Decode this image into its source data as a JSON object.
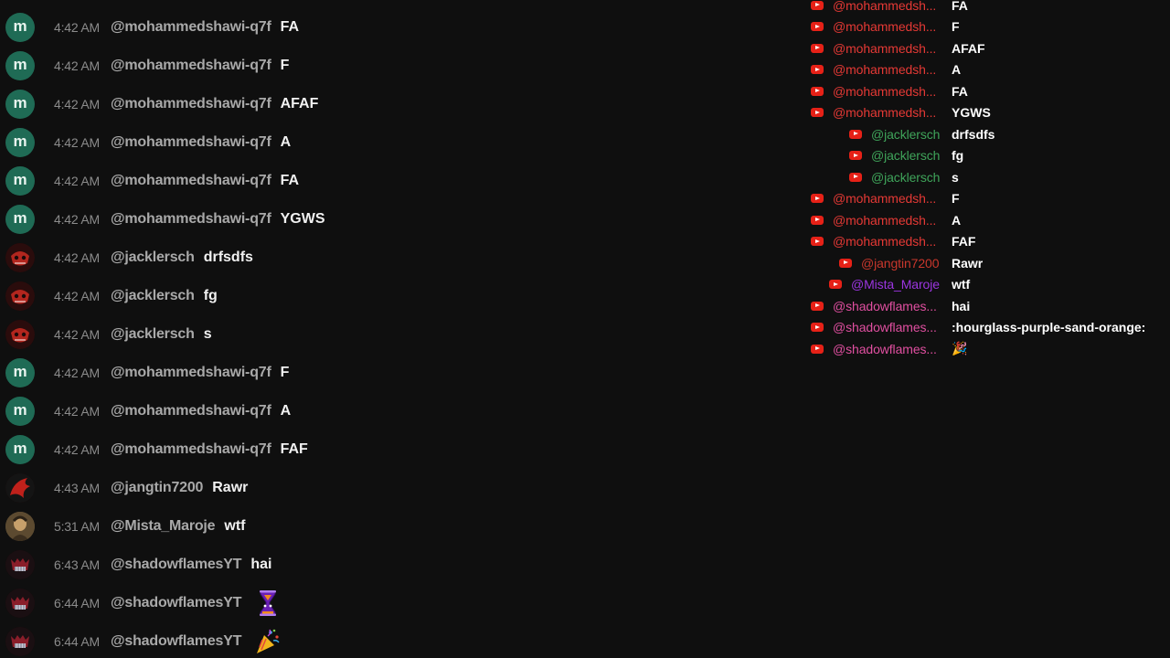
{
  "left_chat": [
    {
      "avatar": "m",
      "avatar_icon": "letter-m-avatar",
      "time": "4:42 AM",
      "name": "@mohammedshawi-q7f",
      "message": "FA"
    },
    {
      "avatar": "m",
      "avatar_icon": "letter-m-avatar",
      "time": "4:42 AM",
      "name": "@mohammedshawi-q7f",
      "message": "F"
    },
    {
      "avatar": "m",
      "avatar_icon": "letter-m-avatar",
      "time": "4:42 AM",
      "name": "@mohammedshawi-q7f",
      "message": "AFAF"
    },
    {
      "avatar": "m",
      "avatar_icon": "letter-m-avatar",
      "time": "4:42 AM",
      "name": "@mohammedshawi-q7f",
      "message": "A"
    },
    {
      "avatar": "m",
      "avatar_icon": "letter-m-avatar",
      "time": "4:42 AM",
      "name": "@mohammedshawi-q7f",
      "message": "FA"
    },
    {
      "avatar": "m",
      "avatar_icon": "letter-m-avatar",
      "time": "4:42 AM",
      "name": "@mohammedshawi-q7f",
      "message": "YGWS"
    },
    {
      "avatar": "",
      "avatar_icon": "red-mask-avatar",
      "time": "4:42 AM",
      "name": "@jacklersch",
      "message": "drfsdfs"
    },
    {
      "avatar": "",
      "avatar_icon": "red-mask-avatar",
      "time": "4:42 AM",
      "name": "@jacklersch",
      "message": "fg"
    },
    {
      "avatar": "",
      "avatar_icon": "red-mask-avatar",
      "time": "4:42 AM",
      "name": "@jacklersch",
      "message": "s"
    },
    {
      "avatar": "m",
      "avatar_icon": "letter-m-avatar",
      "time": "4:42 AM",
      "name": "@mohammedshawi-q7f",
      "message": "F"
    },
    {
      "avatar": "m",
      "avatar_icon": "letter-m-avatar",
      "time": "4:42 AM",
      "name": "@mohammedshawi-q7f",
      "message": "A"
    },
    {
      "avatar": "m",
      "avatar_icon": "letter-m-avatar",
      "time": "4:42 AM",
      "name": "@mohammedshawi-q7f",
      "message": "FAF"
    },
    {
      "avatar": "",
      "avatar_icon": "red-dragon-avatar",
      "time": "4:43 AM",
      "name": "@jangtin7200",
      "message": "Rawr"
    },
    {
      "avatar": "",
      "avatar_icon": "photo-avatar",
      "time": "5:31 AM",
      "name": "@Mista_Maroje",
      "message": "wtf"
    },
    {
      "avatar": "",
      "avatar_icon": "demon-avatar",
      "time": "6:43 AM",
      "name": "@shadowflamesYT",
      "message": "hai"
    },
    {
      "avatar": "",
      "avatar_icon": "demon-avatar",
      "time": "6:44 AM",
      "name": "@shadowflamesYT",
      "message": "",
      "emoji": "hourglass-purple-sand-orange-icon"
    },
    {
      "avatar": "",
      "avatar_icon": "demon-avatar",
      "time": "6:44 AM",
      "name": "@shadowflamesYT",
      "message": "",
      "emoji": "party-popper-icon"
    }
  ],
  "right_chat": [
    {
      "name": "@mohammedsh...",
      "message": "FA",
      "color": "#e53935"
    },
    {
      "name": "@mohammedsh...",
      "message": "F",
      "color": "#e53935"
    },
    {
      "name": "@mohammedsh...",
      "message": "AFAF",
      "color": "#e53935"
    },
    {
      "name": "@mohammedsh...",
      "message": "A",
      "color": "#e53935"
    },
    {
      "name": "@mohammedsh...",
      "message": "FA",
      "color": "#e53935"
    },
    {
      "name": "@mohammedsh...",
      "message": "YGWS",
      "color": "#e53935"
    },
    {
      "name": "@jacklersch",
      "message": "drfsdfs",
      "color": "#3fa45a"
    },
    {
      "name": "@jacklersch",
      "message": "fg",
      "color": "#3fa45a"
    },
    {
      "name": "@jacklersch",
      "message": "s",
      "color": "#3fa45a"
    },
    {
      "name": "@mohammedsh...",
      "message": "F",
      "color": "#e53935"
    },
    {
      "name": "@mohammedsh...",
      "message": "A",
      "color": "#e53935"
    },
    {
      "name": "@mohammedsh...",
      "message": "FAF",
      "color": "#e53935"
    },
    {
      "name": "@jangtin7200",
      "message": "Rawr",
      "color": "#c9372c"
    },
    {
      "name": "@Mista_Maroje",
      "message": "wtf",
      "color": "#9b35e0"
    },
    {
      "name": "@shadowflames...",
      "message": "hai",
      "color": "#e04fa0"
    },
    {
      "name": "@shadowflames...",
      "message": ":hourglass-purple-sand-orange:",
      "color": "#e04fa0"
    },
    {
      "name": "@shadowflames...",
      "message": "🎉",
      "color": "#e04fa0"
    }
  ]
}
